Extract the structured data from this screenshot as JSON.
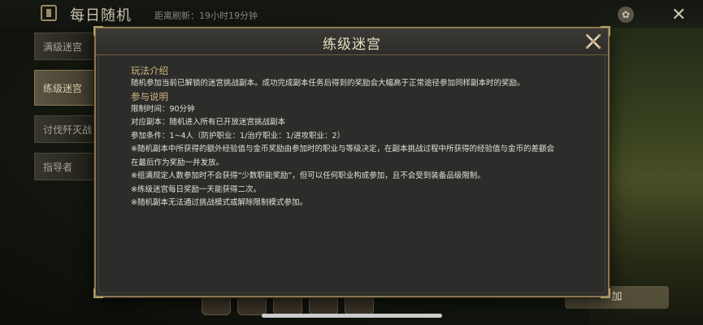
{
  "topbar": {
    "title": "每日随机",
    "refresh": "距离刷新：19小时19分钟"
  },
  "sidebar": {
    "items": [
      {
        "label": "满级迷宫"
      },
      {
        "label": "练级迷宫"
      },
      {
        "label": "讨伐歼灭战"
      },
      {
        "label": "指导者"
      }
    ]
  },
  "join_button": "加",
  "modal": {
    "title": "练级迷宫",
    "section1_title": "玩法介绍",
    "section1_text": "随机参加当前已解锁的迷宫挑战副本。成功完成副本任务后得到的奖励会大幅高于正常途径参加同样副本时的奖励。",
    "section2_title": "参与说明",
    "limit_time": "限制时间：90分钟",
    "target": "对应副本：随机进入所有已开放迷宫挑战副本",
    "condition": "参加条件：1~4人（防护职业：1/治疗职业：1/进攻职业：2）",
    "note1_a": "※随机副本中所获得的额外经验值与金币奖励由参加时的职业与等级决定，在副本挑战过程中所获得的经验值与金币的差额会",
    "note1_b": "在最后作为奖励一并发放。",
    "note2": "※组满规定人数参加时不会获得“少数职能奖励”，但可以任何职业构成参加，且不会受到装备品级限制。",
    "note3": "※练级迷宫每日奖励一天能获得二次。",
    "note4": "※随机副本无法通过挑战模式或解除限制模式参加。"
  },
  "colors": {
    "accent_gold": "#d2b882",
    "border_gold": "#8a7650",
    "modal_bg": "#2c2c2a",
    "text": "#e4e0d6"
  },
  "icons": [
    "castle-icon",
    "paw-icon",
    "close-icon"
  ]
}
